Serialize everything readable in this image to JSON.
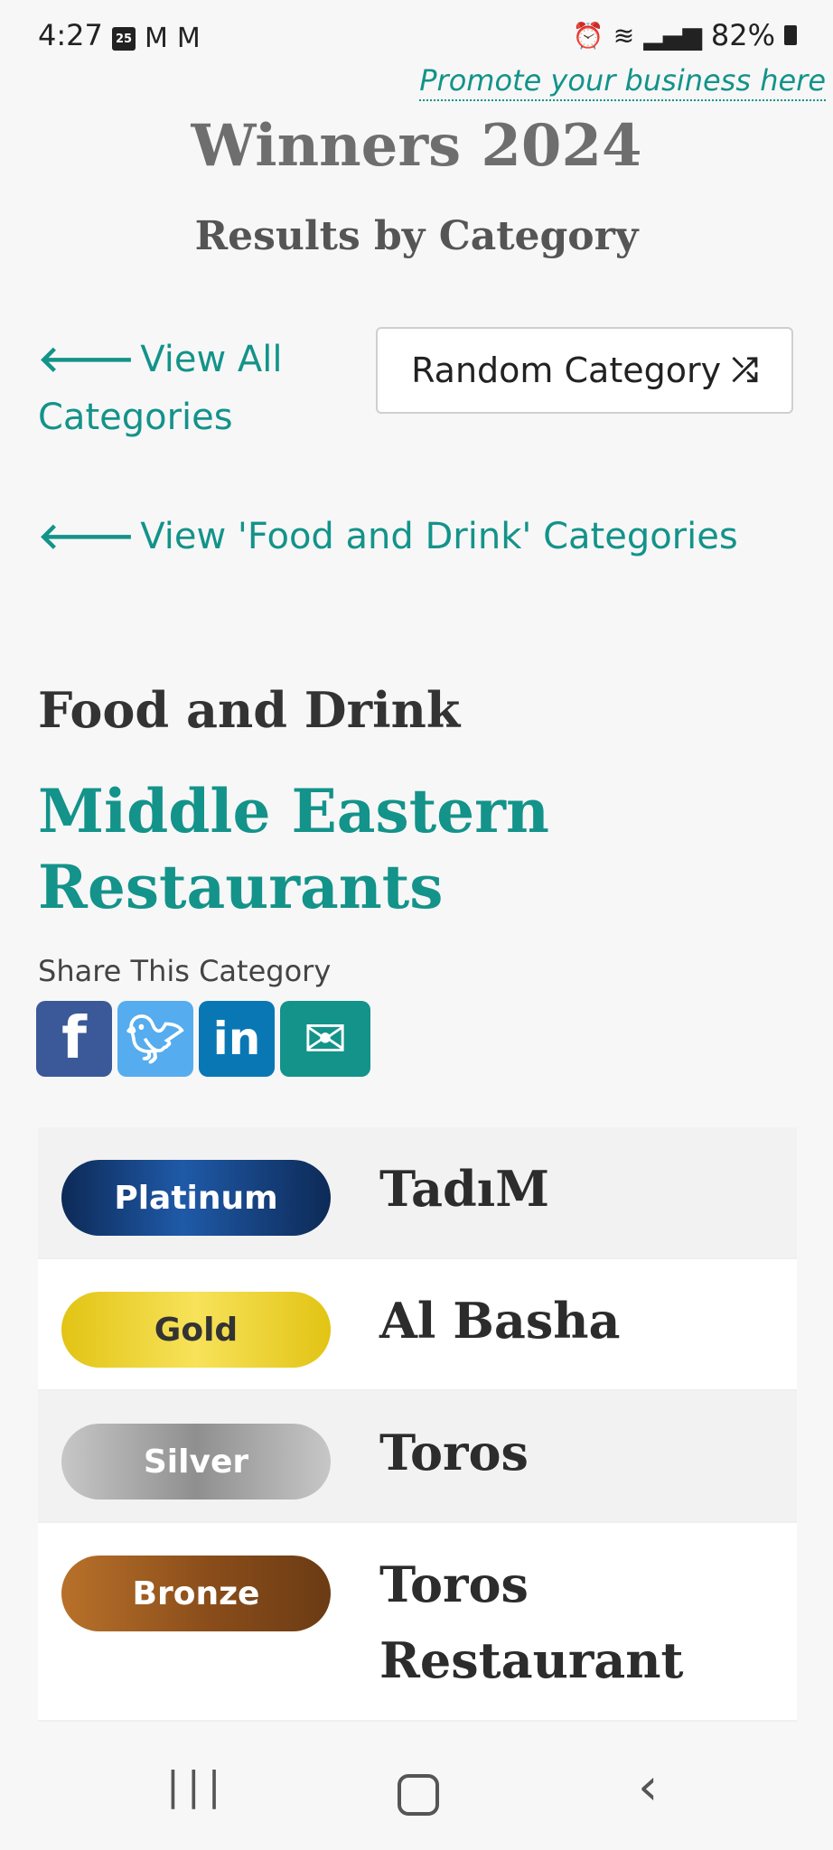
{
  "status_bar": {
    "time": "4:27",
    "calendar_day": "25",
    "battery": "82%"
  },
  "header": {
    "promote_link": "Promote your business here",
    "title": "Winners 2024",
    "subtitle": "Results by Category"
  },
  "nav": {
    "view_all": "View All Categories",
    "random_button": "Random Category",
    "view_group": "View 'Food and Drink' Categories"
  },
  "category": {
    "group": "Food and Drink",
    "name": "Middle Eastern Restaurants",
    "share_label": "Share This Category"
  },
  "share": {
    "icons": [
      "facebook-icon",
      "twitter-icon",
      "linkedin-icon",
      "email-icon"
    ]
  },
  "results": [
    {
      "tier": "Platinum",
      "winner": "TadıM"
    },
    {
      "tier": "Gold",
      "winner": "Al Basha"
    },
    {
      "tier": "Silver",
      "winner": "Toros"
    },
    {
      "tier": "Bronze",
      "winner": "Toros Restaurant"
    }
  ],
  "colors": {
    "accent": "#13938a",
    "platinum": "#1f5aa8",
    "gold": "#f0d634",
    "silver": "#a8a8a8",
    "bronze": "#9a5a22"
  }
}
